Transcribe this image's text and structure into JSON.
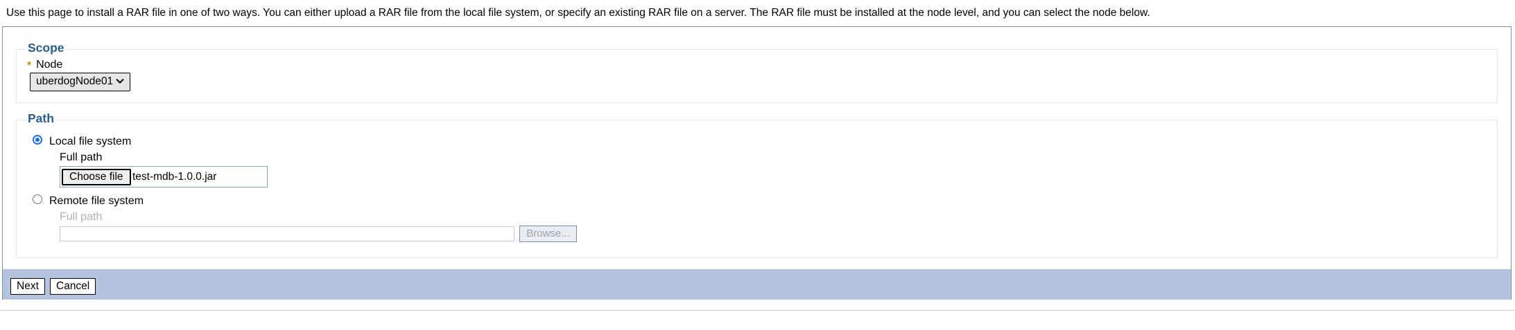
{
  "intro_text": "Use this page to install a RAR file in one of two ways. You can either upload a RAR file from the local file system, or specify an existing RAR file on a server. The RAR file must be installed at the node level, and you can select the node below.",
  "scope": {
    "legend": "Scope",
    "node_label": "Node",
    "required_marker": "✶",
    "node_value": "uberdogNode01",
    "chevron_icon": "chevron-down-icon"
  },
  "path": {
    "legend": "Path",
    "local": {
      "label": "Local file system",
      "selected": true,
      "field_label": "Full path",
      "choose_button": "Choose file",
      "file_name": "test-mdb-1.0.0.jar"
    },
    "remote": {
      "label": "Remote file system",
      "selected": false,
      "field_label": "Full path",
      "input_value": "",
      "browse_button": "Browse..."
    }
  },
  "buttons": {
    "next": "Next",
    "cancel": "Cancel"
  },
  "colors": {
    "legend": "#2a5d8e",
    "button_bar": "#b4c4de",
    "radio_accent": "#1a73e8",
    "required_marker": "#c28a00"
  }
}
